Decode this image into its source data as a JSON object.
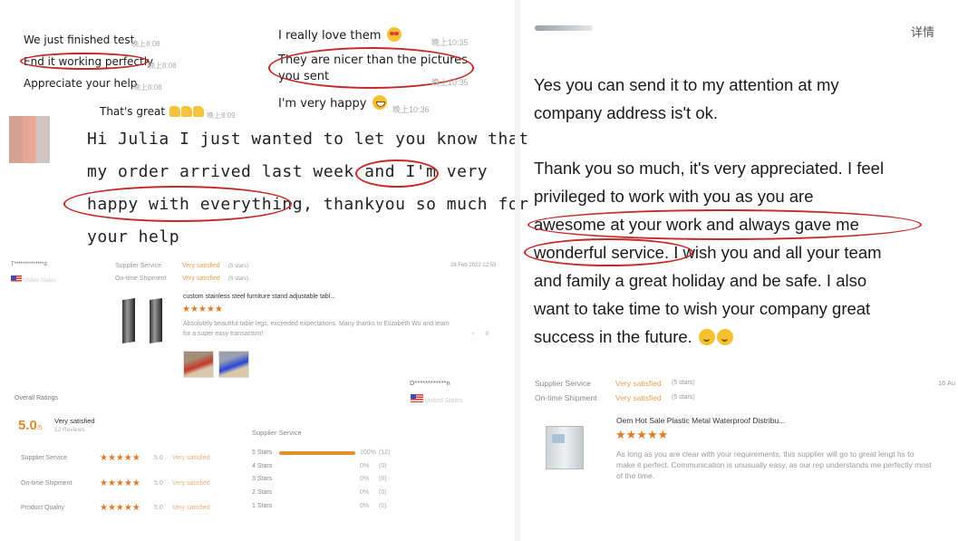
{
  "chat1": {
    "messages": [
      {
        "text": "We just finished test",
        "time": "晚上8:08"
      },
      {
        "text": "End it working perfectly",
        "time": "晚上8:08",
        "highlighted": true
      },
      {
        "text": "Appreciate your help",
        "time": "晚上8:08"
      }
    ],
    "reply": {
      "text": "That's great",
      "emoji": "thumbs-up x3",
      "time": "晚上8:09"
    }
  },
  "chat2": {
    "messages": [
      {
        "text": "I really love them",
        "emoji": "heart-eyes",
        "time": "晚上10:35"
      },
      {
        "text_line1": "They are nicer than the pictures",
        "text_line2": "you sent",
        "time": "晚上10:35",
        "highlighted": true
      },
      {
        "text": "I'm very happy",
        "emoji": "grin",
        "time": "晚上10:36"
      }
    ]
  },
  "handwritten": {
    "lines": [
      "Hi Julia I just wanted to let you know that",
      "my order arrived last week and I'm very",
      "happy with everything, thankyou so much for",
      "your help"
    ]
  },
  "review1": {
    "reviewer": "T**************d",
    "country": "United States",
    "date": "28 Feb 2022 12:53",
    "supplier_service_label": "Supplier Service",
    "supplier_service_value": "Very satisfied",
    "supplier_service_stars": "(5 stars)",
    "shipment_label": "On-time Shipment",
    "shipment_value": "Very satisfied",
    "shipment_stars": "(5 stars)",
    "product_title": "custom stainless steel furniture stand adjustable tabl...",
    "rating": 5,
    "stars": "★★★★★",
    "body": "Absolutely beautiful table legs, exceeded expectations.  Many thanks to Elizabeth Wu and team for a super easy transaction!",
    "likes": "0"
  },
  "review2_header": {
    "reviewer": "D************n",
    "country": "United States"
  },
  "overall": {
    "title": "Overall Ratings",
    "score": "5.0",
    "score_suffix": "/5",
    "summary": "Very satisfied",
    "reviews": "12 Reviews",
    "rows": [
      {
        "label": "Supplier Service",
        "stars": "★★★★★",
        "value": "5.0",
        "text": "Very satisfied"
      },
      {
        "label": "On-time Shipment",
        "stars": "★★★★★",
        "value": "5.0",
        "text": "Very satisfied"
      },
      {
        "label": "Product Quality",
        "stars": "★★★★★",
        "value": "5.0",
        "text": "Very satisfied"
      }
    ],
    "breakdown_title": "Supplier Service",
    "breakdown": [
      {
        "label": "5 Stars",
        "percent": "100%",
        "count": "(12)",
        "fraction": 1.0
      },
      {
        "label": "4 Stars",
        "percent": "0%",
        "count": "(0)",
        "fraction": 0
      },
      {
        "label": "3 Stars",
        "percent": "0%",
        "count": "(0)",
        "fraction": 0
      },
      {
        "label": "2 Stars",
        "percent": "0%",
        "count": "(0)",
        "fraction": 0
      },
      {
        "label": "1 Stars",
        "percent": "0%",
        "count": "(0)",
        "fraction": 0
      }
    ],
    "accent": "#e0902f"
  },
  "right": {
    "header_link": "详情",
    "paragraph1": [
      "Yes you can send it to my attention at my",
      "company address is't ok."
    ],
    "paragraph2": [
      "Thank you so much, it's very appreciated. I feel",
      "privileged to work with you as you are",
      "awesome at your work and always gave me",
      "wonderful service. I wish you and all your team",
      "and family a great holiday and be safe. I also",
      "want to take time to wish your company great",
      "success in the future."
    ],
    "review": {
      "supplier_service_label": "Supplier Service",
      "supplier_service_value": "Very satisfied",
      "supplier_service_stars": "(5 stars)",
      "shipment_label": "On-time Shipment",
      "shipment_value": "Very satisfied",
      "shipment_stars": "(5 stars)",
      "date": "16 Au",
      "product_title": "Oem Hot Sale Plastic Metal Waterproof Distribu...",
      "rating": 5,
      "stars": "★★★★★",
      "body": "As long as you are clear with your requirements, this supplier will go to great lengt hs to make it perfect. Communication is unusually easy, as our rep understands me perfectly most of the time."
    }
  },
  "colors": {
    "highlight_ring": "#c62828",
    "star": "#e27a22",
    "satisfied": "#e8a04e"
  }
}
